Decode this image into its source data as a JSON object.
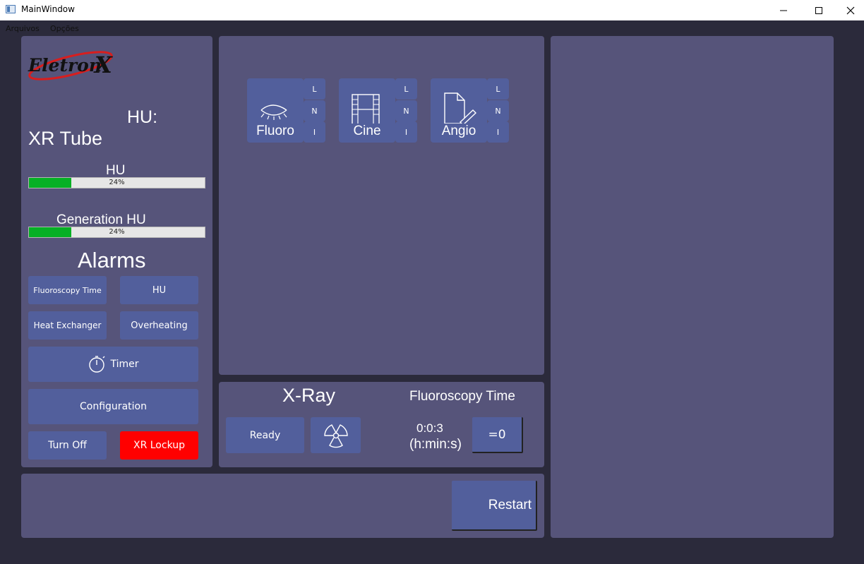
{
  "window": {
    "title": "MainWindow"
  },
  "menu": {
    "items": [
      "Arquivos",
      "Opções"
    ]
  },
  "left_panel": {
    "logo_text": "Eletron X",
    "hu_label": "HU:",
    "tube_title": "XR Tube",
    "hu_bar": {
      "label": "HU",
      "value_text": "24%",
      "value": 24
    },
    "gen_bar": {
      "label": "Generation HU",
      "value_text": "24%",
      "value": 24
    },
    "alarms_title": "Alarms",
    "buttons": {
      "fluoro_time": "Fluoroscopy Time",
      "hu": "HU",
      "heat_exchanger": "Heat Exchanger",
      "overheating": "Overheating",
      "timer": "Timer",
      "configuration": "Configuration",
      "turn_off": "Turn Off",
      "xr_lockup": "XR Lockup"
    },
    "colors": {
      "lockup": "#ff0000",
      "bar_fill": "#06b025"
    }
  },
  "modes": [
    {
      "label": "Fluoro",
      "icon": "eye-icon",
      "subs": [
        "L",
        "N",
        "I"
      ]
    },
    {
      "label": "Cine",
      "icon": "film-icon",
      "subs": [
        "L",
        "N",
        "I"
      ]
    },
    {
      "label": "Angio",
      "icon": "document-edit-icon",
      "subs": [
        "L",
        "N",
        "I"
      ]
    }
  ],
  "xray_panel": {
    "title": "X-Ray",
    "ready_label": "Ready",
    "fluoro_title": "Fluoroscopy Time",
    "time_value": "0:0:3",
    "time_unit": "(h:min:s)",
    "reset_label": "=0"
  },
  "bottom_panel": {
    "restart_label": "Restart"
  },
  "colors": {
    "background": "#2b2a3b",
    "panel": "#56547a",
    "button": "#525f9c"
  }
}
